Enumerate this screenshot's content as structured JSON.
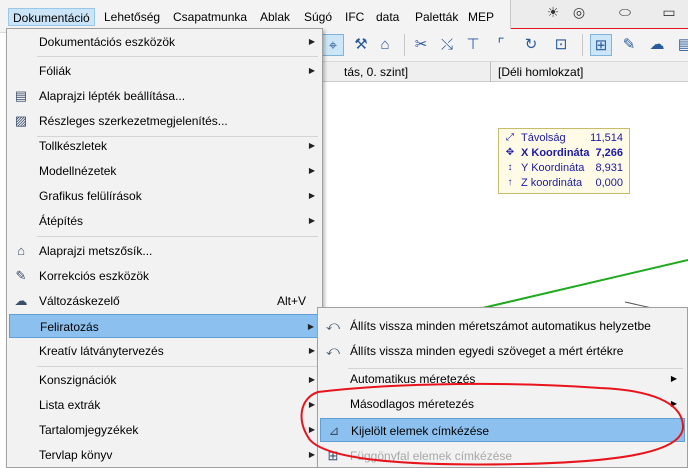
{
  "menubar": {
    "items": [
      "Dokumentáció",
      "Lehetőség",
      "Csapatmunka",
      "Ablak",
      "Súgó",
      "IFC",
      "data",
      "Paletták",
      "MEP"
    ]
  },
  "tabs": [
    {
      "label": "tás, 0. szint]"
    },
    {
      "label": "[Déli homlokzat]"
    }
  ],
  "tracker": {
    "rows": [
      {
        "icon": "⤢",
        "label": "Távolság",
        "value": "11,514"
      },
      {
        "icon": "✥",
        "label": "X Koordináta",
        "value": "7,266"
      },
      {
        "icon": "↕",
        "label": "Y Koordináta",
        "value": "8,931"
      },
      {
        "icon": "↑",
        "label": "Z koordináta",
        "value": "0,000"
      }
    ]
  },
  "menu": {
    "items": [
      {
        "label": "Dokumentációs eszközök",
        "icon": "",
        "shortcut": "",
        "arrow": "▶"
      },
      {
        "label": "Fóliák",
        "icon": "",
        "shortcut": "",
        "arrow": "▶"
      },
      {
        "label": "Alaprajzi lépték beállítása...",
        "icon": "▤",
        "shortcut": "",
        "arrow": ""
      },
      {
        "label": "Részleges szerkezetmegjelenítés...",
        "icon": "▨",
        "shortcut": "",
        "arrow": ""
      },
      {
        "label": "Tollkészletek",
        "icon": "",
        "shortcut": "",
        "arrow": "▶"
      },
      {
        "label": "Modellnézetek",
        "icon": "",
        "shortcut": "",
        "arrow": "▶"
      },
      {
        "label": "Grafikus felülírások",
        "icon": "",
        "shortcut": "",
        "arrow": "▶"
      },
      {
        "label": "Átépítés",
        "icon": "",
        "shortcut": "",
        "arrow": "▶"
      },
      {
        "label": "Alaprajzi metszősík...",
        "icon": "⌂",
        "shortcut": "",
        "arrow": ""
      },
      {
        "label": "Korrekciós eszközök",
        "icon": "✎",
        "shortcut": "",
        "arrow": ""
      },
      {
        "label": "Változáskezelő",
        "icon": "☁",
        "shortcut": "Alt+V",
        "arrow": ""
      },
      {
        "label": "Feliratozás",
        "icon": "",
        "shortcut": "",
        "arrow": "▶"
      },
      {
        "label": "Kreatív látványtervezés",
        "icon": "",
        "shortcut": "",
        "arrow": "▶"
      },
      {
        "label": "Konszignációk",
        "icon": "",
        "shortcut": "",
        "arrow": "▶"
      },
      {
        "label": "Lista extrák",
        "icon": "",
        "shortcut": "",
        "arrow": "▶"
      },
      {
        "label": "Tartalomjegyzékek",
        "icon": "",
        "shortcut": "",
        "arrow": "▶"
      },
      {
        "label": "Tervlap könyv",
        "icon": "",
        "shortcut": "",
        "arrow": "▶"
      }
    ]
  },
  "submenu": {
    "items": [
      {
        "label": "Állíts vissza minden méretszámot automatikus helyzetbe",
        "icon": "⤺",
        "arrow": ""
      },
      {
        "label": "Állíts vissza minden egyedi szöveget a mért értékre",
        "icon": "⤺",
        "arrow": ""
      },
      {
        "label": "Automatikus méretezés",
        "icon": "",
        "arrow": "▶"
      },
      {
        "label": "Másodlagos méretezés",
        "icon": "",
        "arrow": "▶"
      },
      {
        "label": "Kijelölt elemek címkézése",
        "icon": "⊿",
        "arrow": ""
      },
      {
        "label": "Függönyfal elemek címkézése",
        "icon": "⊞",
        "arrow": ""
      }
    ]
  },
  "colors": {
    "highlight": "#8cc0ee",
    "annotation": "#e8141c",
    "tracker_text": "#1a1aa8",
    "canvas_line": "#1faa1f"
  }
}
